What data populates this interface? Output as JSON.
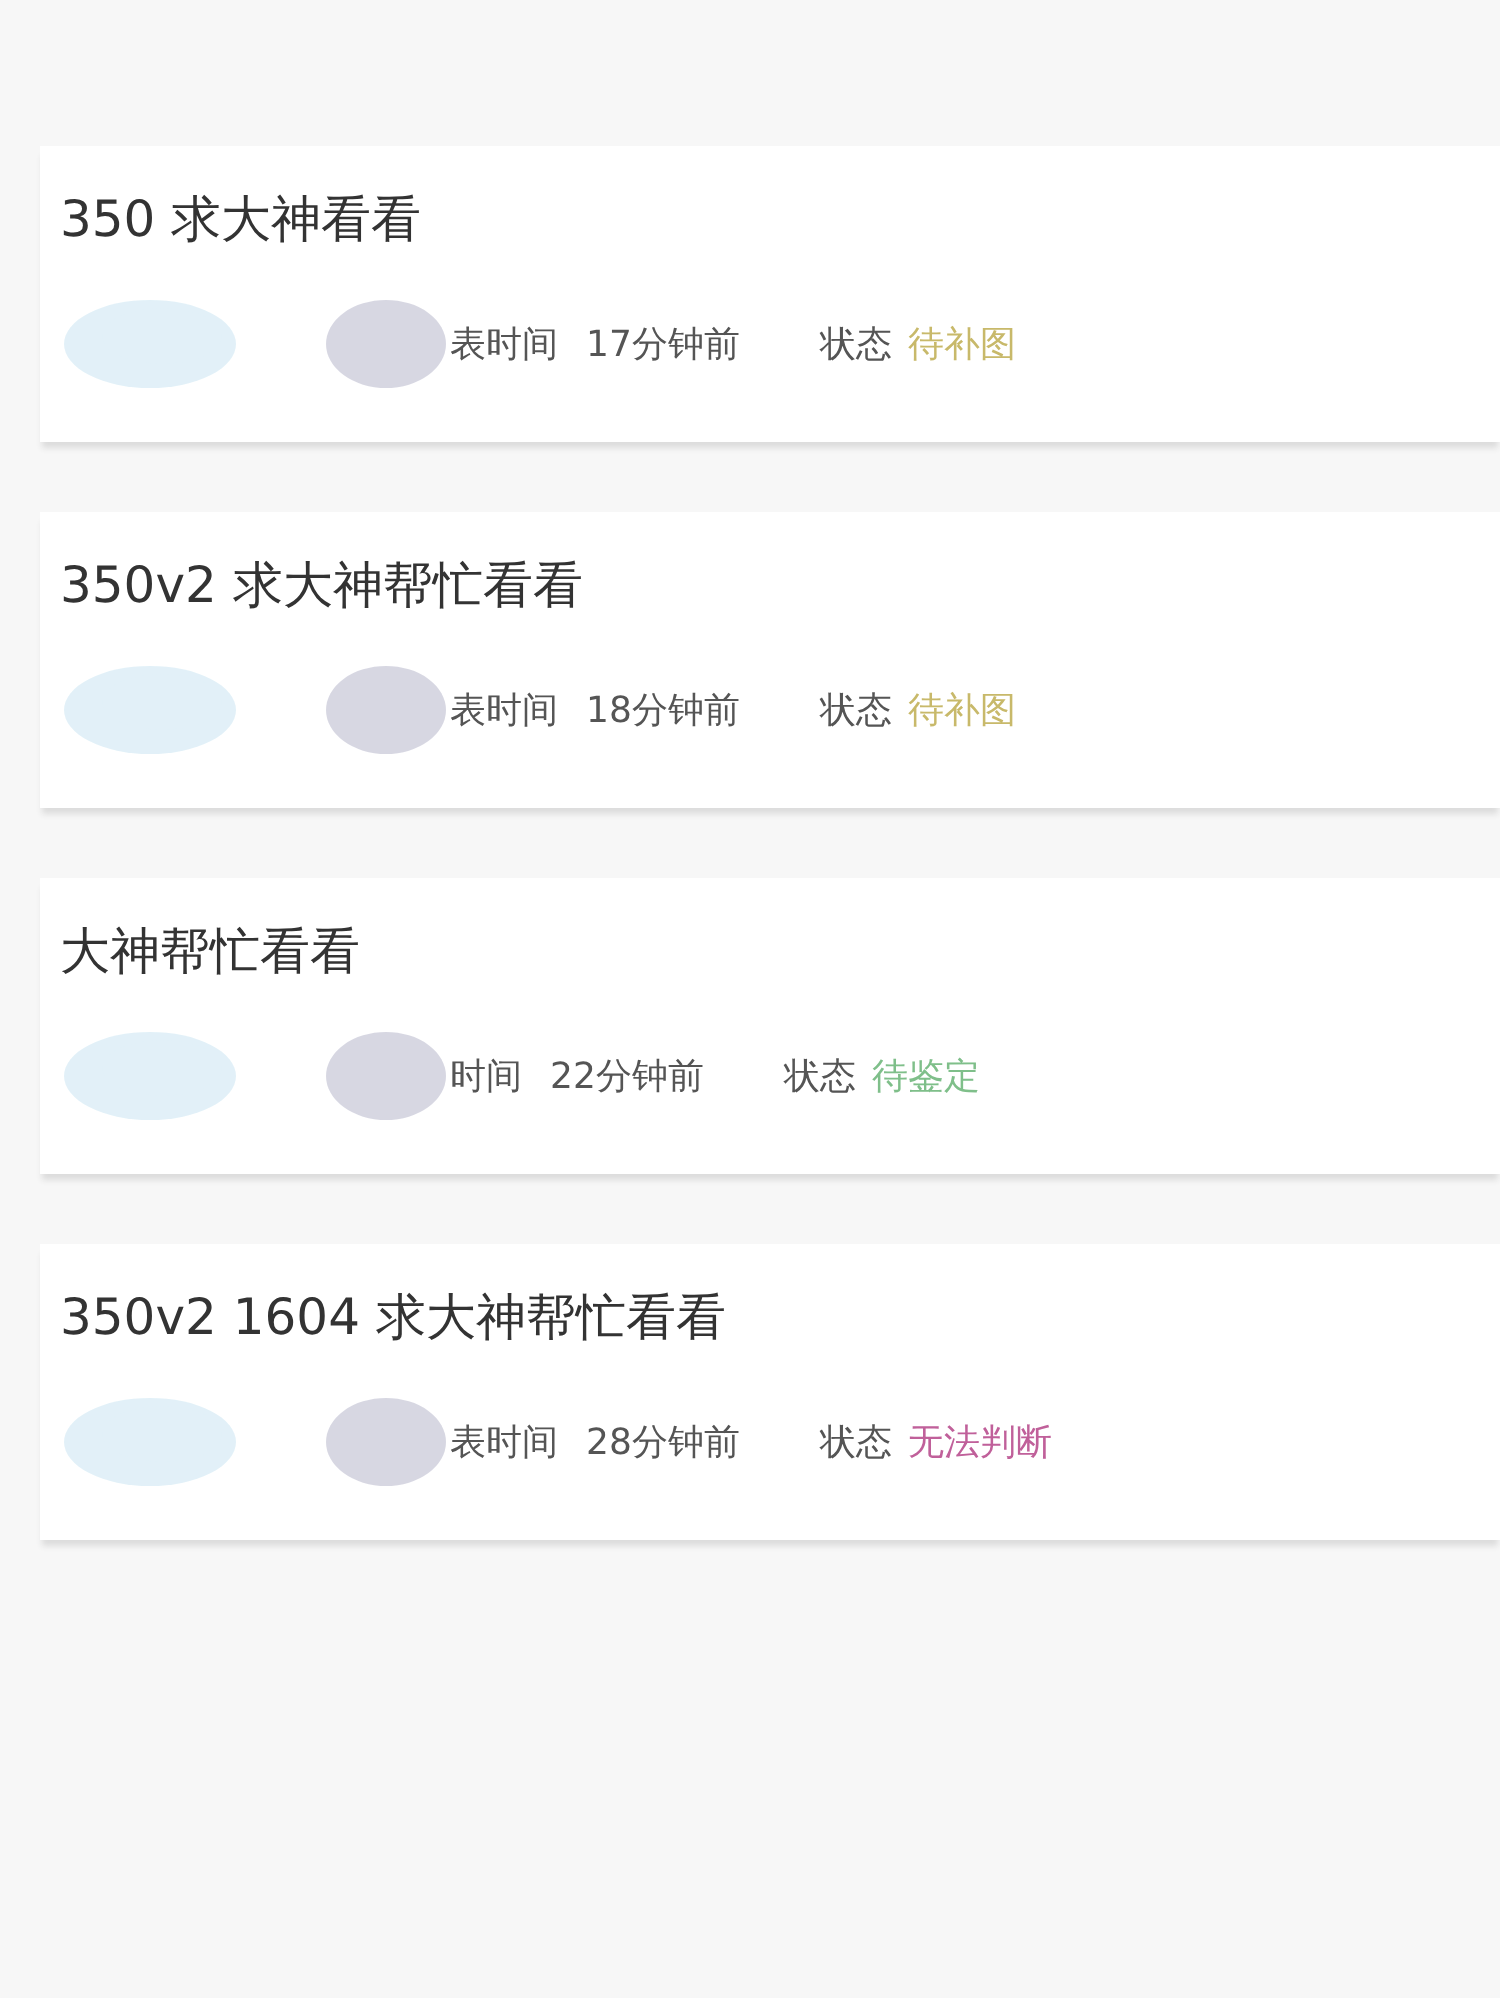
{
  "posts": [
    {
      "title": "350 求大神看看",
      "time_label": "表时间",
      "time": "17分钟前",
      "status_label": "状态",
      "status": {
        "text": "待补图",
        "color": "#c8b96a"
      }
    },
    {
      "title": "350v2 求大神帮忙看看",
      "time_label": "表时间",
      "time": "18分钟前",
      "status_label": "状态",
      "status": {
        "text": "待补图",
        "color": "#c8b96a"
      }
    },
    {
      "title": "大神帮忙看看",
      "time_label": "时间",
      "time": "22分钟前",
      "status_label": "状态",
      "status": {
        "text": "待鉴定",
        "color": "#7fbf8a"
      }
    },
    {
      "title": "350v2 1604 求大神帮忙看看",
      "time_label": "表时间",
      "time": "28分钟前",
      "status_label": "状态",
      "status": {
        "text": "无法判断",
        "color": "#c0609a"
      }
    }
  ]
}
